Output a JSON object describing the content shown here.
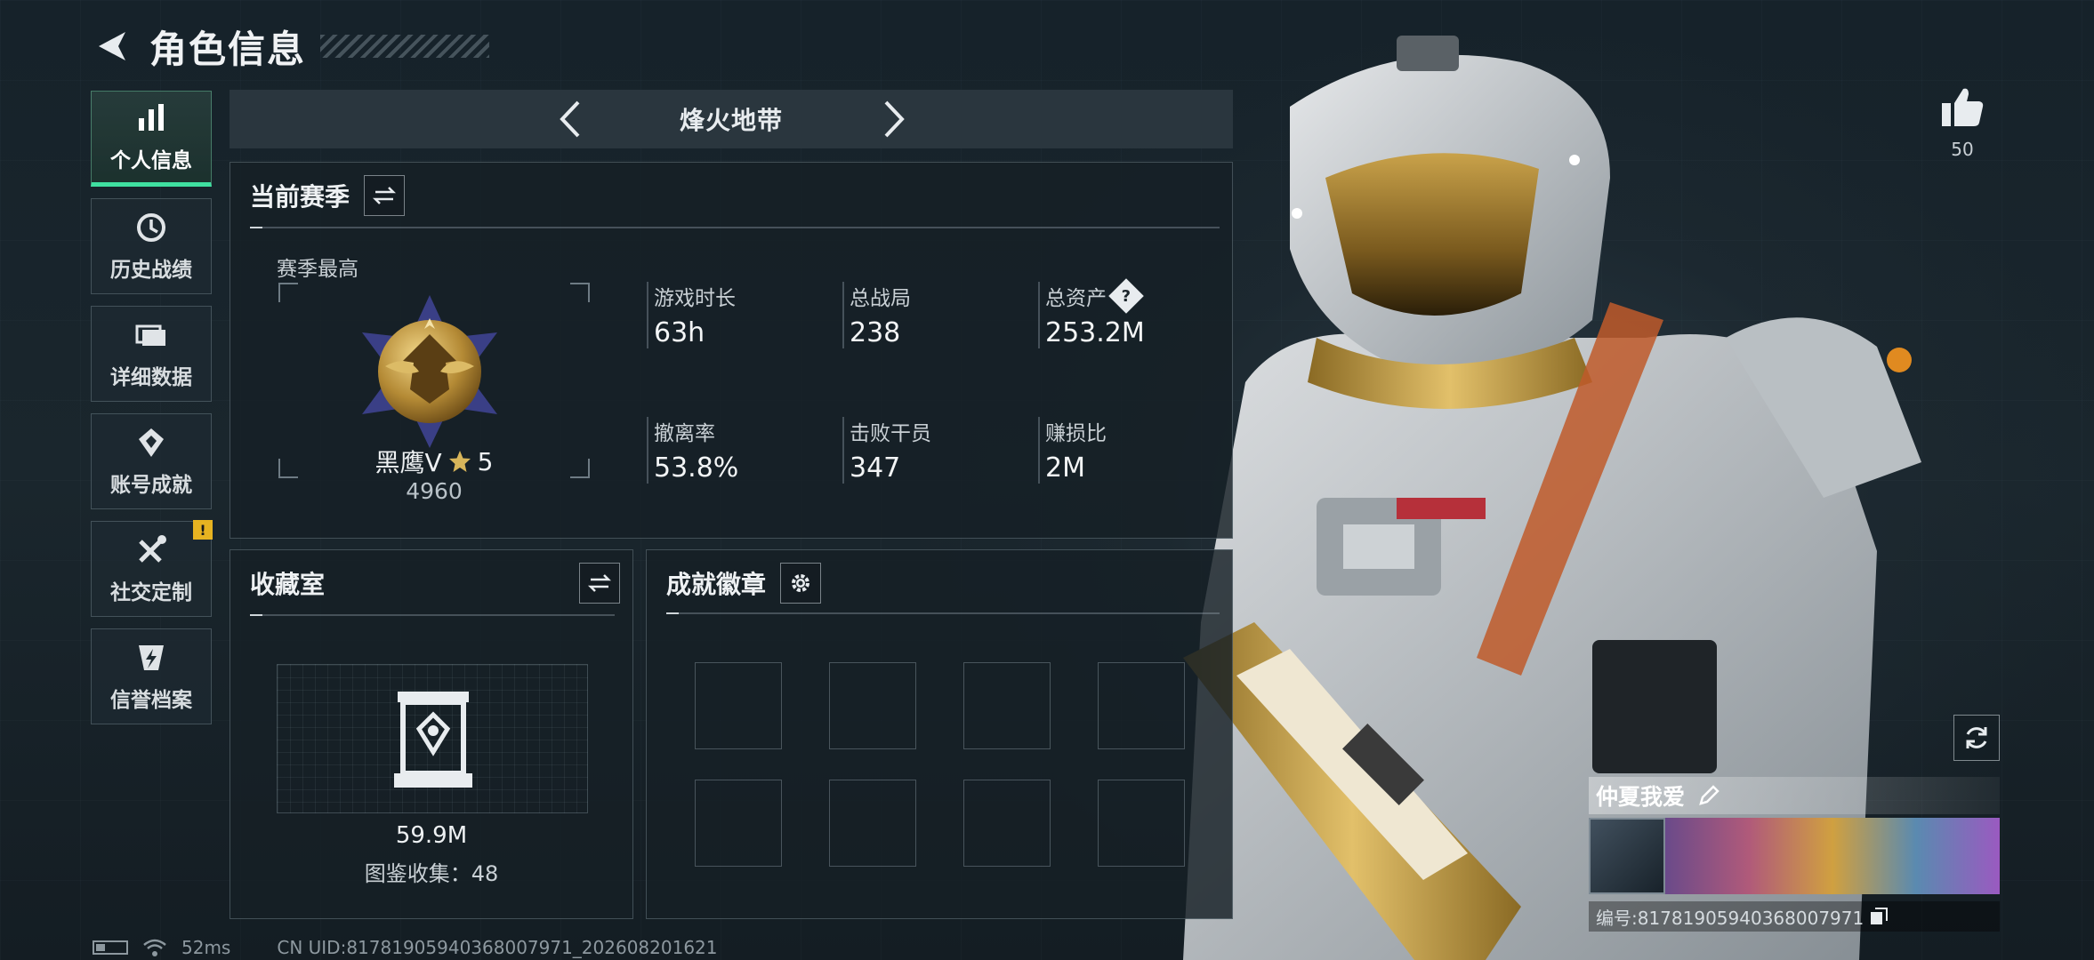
{
  "header": {
    "title": "角色信息"
  },
  "sidebar": {
    "items": [
      {
        "label": "个人信息",
        "icon": "bar-chart-icon",
        "active": true
      },
      {
        "label": "历史战绩",
        "icon": "history-icon"
      },
      {
        "label": "详细数据",
        "icon": "folder-icon"
      },
      {
        "label": "账号成就",
        "icon": "achievement-icon"
      },
      {
        "label": "社交定制",
        "icon": "tools-icon",
        "alert": "!"
      },
      {
        "label": "信誉档案",
        "icon": "credibility-icon"
      }
    ]
  },
  "mode": {
    "title": "烽火地带"
  },
  "season": {
    "title": "当前赛季",
    "best_label": "赛季最高",
    "rank_name": "黑鹰V",
    "rank_stars": "5",
    "rank_score": "4960",
    "stats": [
      {
        "label": "游戏时长",
        "value": "63h"
      },
      {
        "label": "总战局",
        "value": "238"
      },
      {
        "label": "总资产",
        "value": "253.2M",
        "help": "?"
      },
      {
        "label": "撤离率",
        "value": "53.8%"
      },
      {
        "label": "击败干员",
        "value": "347"
      },
      {
        "label": "赚损比",
        "value": "2M"
      }
    ]
  },
  "vault": {
    "title": "收藏室",
    "value": "59.9M",
    "collection": "图鉴收集：48"
  },
  "badges": {
    "title": "成就徽章"
  },
  "likes": {
    "count": "50"
  },
  "player_card": {
    "name": "仲夏我爱",
    "id": "编号:81781905940368007971"
  },
  "footer": {
    "ping": "52ms",
    "uid": "CN UID:81781905940368007971_202608201621"
  },
  "colors": {
    "accent": "#3fe0a0",
    "alert": "#e7b321",
    "panel_bg": "#162026"
  }
}
